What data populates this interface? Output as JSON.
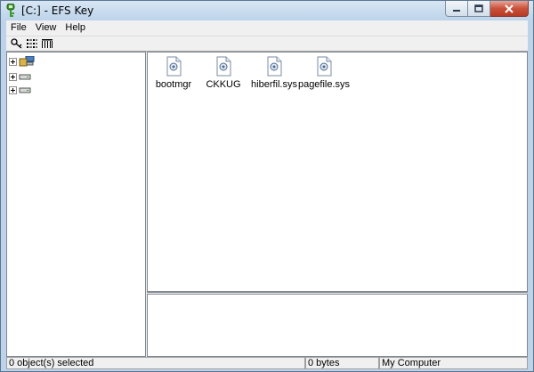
{
  "window": {
    "title": "[C:] - EFS Key",
    "controls": {
      "minimize_icon": "minimize-icon",
      "maximize_icon": "maximize-icon",
      "close_icon": "close-icon"
    }
  },
  "menubar": {
    "items": [
      {
        "label": "File"
      },
      {
        "label": "View"
      },
      {
        "label": "Help"
      }
    ]
  },
  "toolbar": {
    "buttons": [
      {
        "icon": "key-search-icon"
      },
      {
        "icon": "list-view-icon"
      },
      {
        "icon": "details-view-icon"
      }
    ]
  },
  "tree": {
    "nodes": [
      {
        "icon": "my-computer-icon"
      },
      {
        "icon": "drive-icon"
      },
      {
        "icon": "drive-icon"
      }
    ]
  },
  "files": [
    {
      "name": "bootmgr",
      "icon": "file-icon"
    },
    {
      "name": "CKKUG",
      "icon": "file-icon"
    },
    {
      "name": "hiberfil.sys",
      "icon": "file-icon"
    },
    {
      "name": "pagefile.sys",
      "icon": "file-icon"
    }
  ],
  "statusbar": {
    "selection": "0 object(s) selected",
    "size": "0 bytes",
    "location": "My Computer"
  },
  "colors": {
    "titlebar": "#bcd3ea",
    "close_button": "#c9513b",
    "pane_border": "#828790"
  }
}
